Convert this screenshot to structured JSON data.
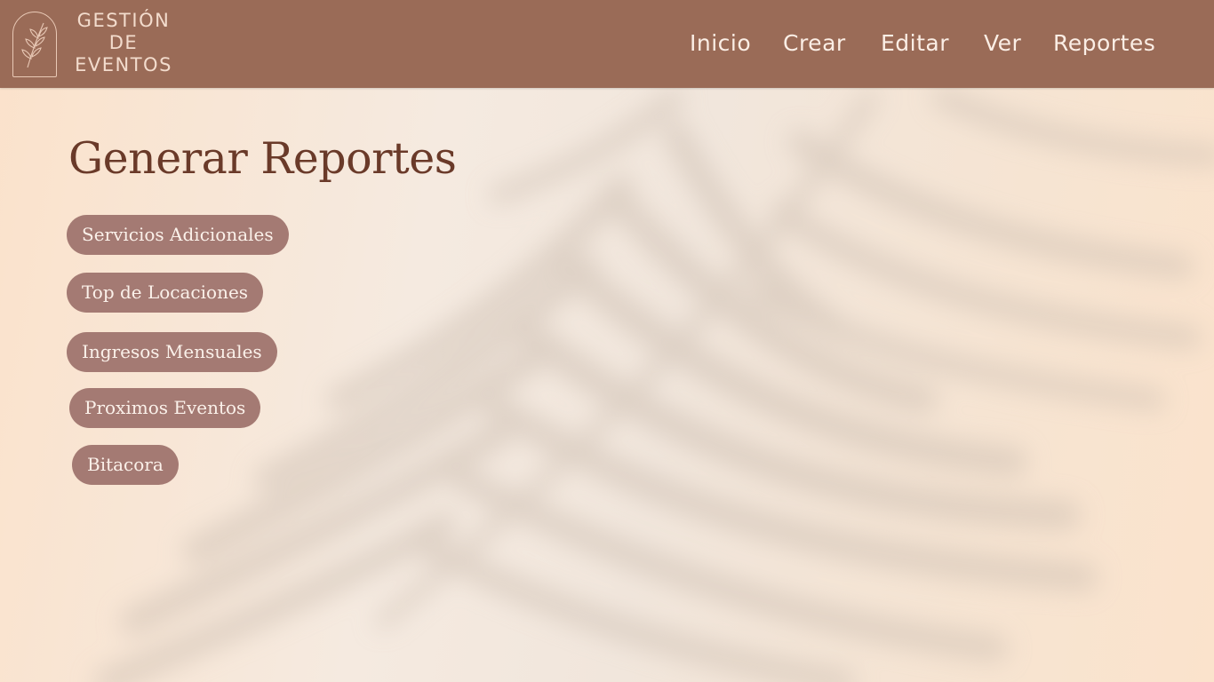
{
  "brand": {
    "line1": "GESTIÓN",
    "line2": "DE",
    "line3": "EVENTOS",
    "icon": "leaf-branch-icon"
  },
  "nav": {
    "items": [
      "Inicio",
      "Crear",
      "Editar",
      "Ver",
      "Reportes"
    ]
  },
  "page": {
    "title": "Generar Reportes"
  },
  "reports": {
    "buttons": [
      "Servicios Adicionales",
      "Top de Locaciones",
      "Ingresos Mensuales",
      "Proximos Eventos",
      "Bitacora"
    ]
  },
  "colors": {
    "header": "#9a6b57",
    "title": "#6a3a29",
    "button": "#a47a73",
    "button_text": "#fbf1ea",
    "nav_text": "#fbeee5"
  }
}
